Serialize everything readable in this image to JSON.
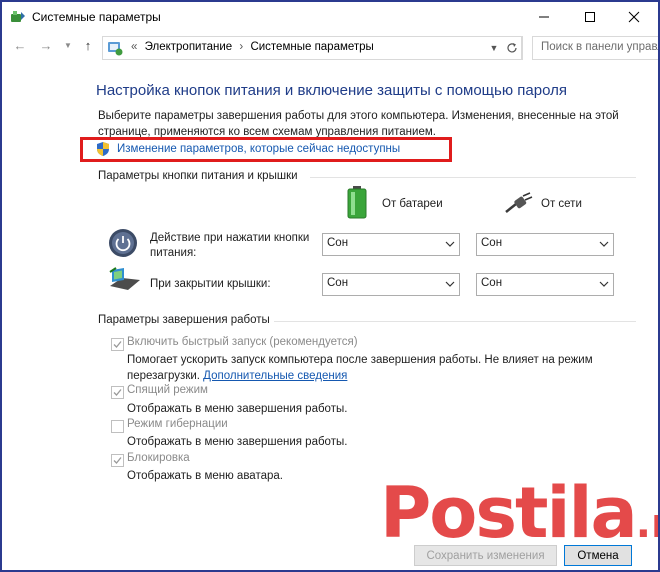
{
  "window": {
    "title": "Системные параметры"
  },
  "address": {
    "crumbs": [
      "Электропитание",
      "Системные параметры"
    ],
    "search_placeholder": "Поиск в панели управл"
  },
  "page": {
    "heading": "Настройка кнопок питания и включение защиты с помощью пароля",
    "description": "Выберите параметры завершения работы для этого компьютера. Изменения, внесенные на этой странице, применяются ко всем схемам управления питанием.",
    "change_link": "Изменение параметров, которые сейчас недоступны"
  },
  "power_buttons": {
    "group_title": "Параметры кнопки питания и крышки",
    "col_battery": "От батареи",
    "col_ac": "От сети",
    "rows": [
      {
        "label": "Действие при нажатии кнопки питания:",
        "battery": "Сон",
        "ac": "Сон"
      },
      {
        "label": "При закрытии крышки:",
        "battery": "Сон",
        "ac": "Сон"
      }
    ]
  },
  "shutdown": {
    "group_title": "Параметры завершения работы",
    "items": [
      {
        "label": "Включить быстрый запуск (рекомендуется)",
        "checked": true,
        "desc": "Помогает ускорить запуск компьютера после завершения работы. Не влияет на режим перезагрузки.",
        "link": "Дополнительные сведения"
      },
      {
        "label": "Спящий режим",
        "checked": true,
        "desc": "Отображать в меню завершения работы."
      },
      {
        "label": "Режим гибернации",
        "checked": false,
        "desc": "Отображать в меню завершения работы."
      },
      {
        "label": "Блокировка",
        "checked": true,
        "desc": "Отображать в меню аватара."
      }
    ]
  },
  "buttons": {
    "save": "Сохранить изменения",
    "cancel": "Отмена"
  },
  "watermark": {
    "brand": "Postila",
    "suffix": ".ru"
  },
  "colors": {
    "heading": "#1f3c88",
    "link": "#1558b0",
    "highlight": "#e01c1c",
    "watermark": "#e23b3b",
    "frame": "#2b3a8f"
  }
}
